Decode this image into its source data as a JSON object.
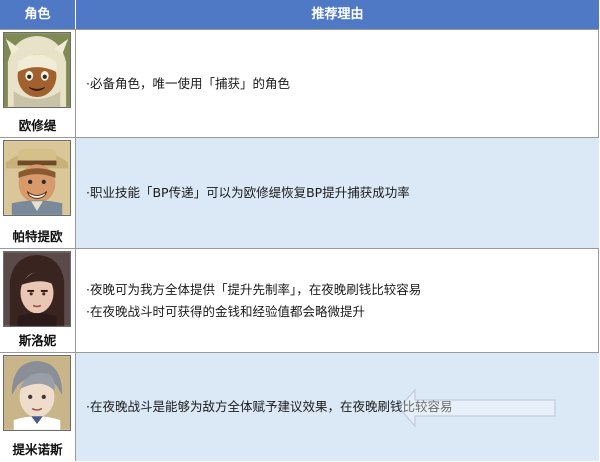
{
  "header": {
    "role_label": "角色",
    "reason_label": "推荐理由"
  },
  "rows": [
    {
      "name": "欧修缇",
      "reasons": [
        "·必备角色，唯一使用「捕获」的角色"
      ]
    },
    {
      "name": "帕特提欧",
      "reasons": [
        "·职业技能「BP传递」可以为欧修缇恢复BP提升捕获成功率"
      ]
    },
    {
      "name": "斯洛妮",
      "reasons": [
        "·夜晚可为我方全体提供「提升先制率」，在夜晚刷钱比较容易",
        "·在夜晚战斗时可获得的金钱和经验值都会略微提升"
      ]
    },
    {
      "name": "提米诺斯",
      "reasons": [
        "·在夜晚战斗是能够为敌方全体赋予建议效果，在夜晚刷钱比较容易"
      ]
    }
  ],
  "colors": {
    "header_bg": "#4f79c4",
    "alt_row_bg": "#dbe8f6",
    "border": "#9a9a9a"
  },
  "icons": {
    "watermark": "watermark-logo"
  }
}
